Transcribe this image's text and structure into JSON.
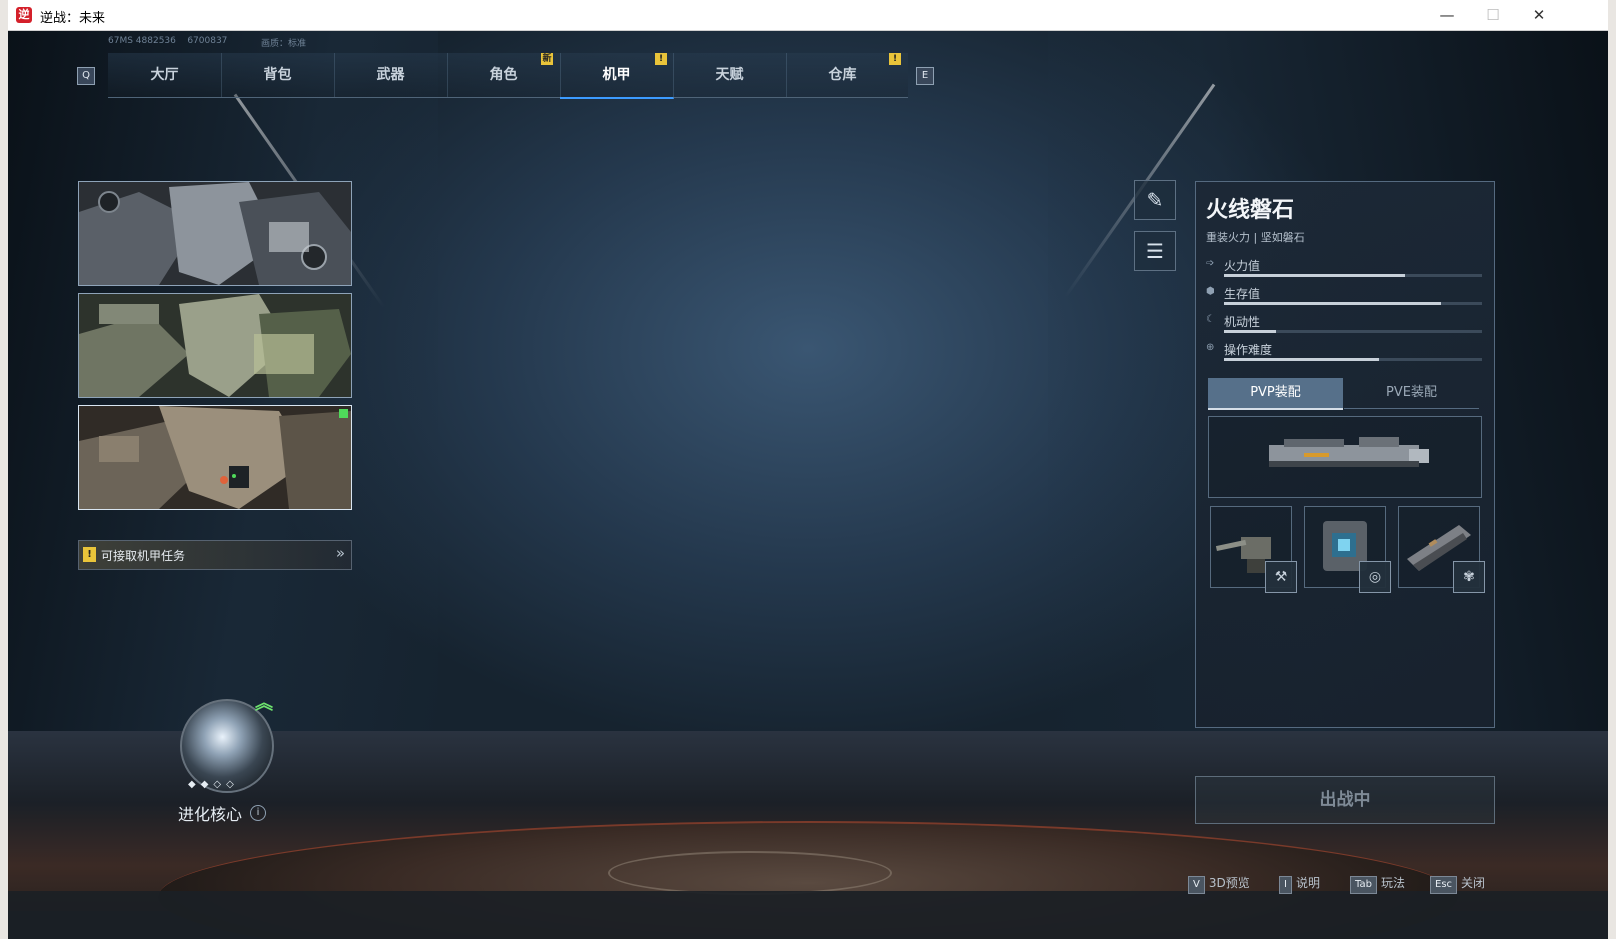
{
  "window": {
    "app_icon": "逆",
    "title": "逆战：未来",
    "minimize": "—",
    "maximize": "☐",
    "close": "✕"
  },
  "meta": {
    "ping": "67MS  4882536",
    "id_tail": "6700837",
    "quality": "画质：标准"
  },
  "nav": {
    "left_key": "Q",
    "right_key": "E",
    "tabs": [
      {
        "label": "大厅"
      },
      {
        "label": "背包"
      },
      {
        "label": "武器"
      },
      {
        "label": "角色",
        "badge": "新"
      },
      {
        "label": "机甲",
        "badge": "!",
        "active": true
      },
      {
        "label": "天赋"
      },
      {
        "label": "仓库",
        "badge": "!"
      }
    ]
  },
  "mech_cards": [
    {
      "name": "mech-card-1",
      "selected": false
    },
    {
      "name": "mech-card-2",
      "selected": false
    },
    {
      "name": "mech-card-3",
      "selected": true
    }
  ],
  "task": {
    "icon": "!",
    "label": "可接取机甲任务",
    "arrow": "»"
  },
  "core": {
    "up_icon": "︽",
    "dots": "◆◆◇◇",
    "label": "进化核心",
    "info": "i"
  },
  "tools": {
    "spray_icon": "✎",
    "list_icon": "☰"
  },
  "panel": {
    "name": "火线磐石",
    "subtitle": "重装火力 | 坚如磐石",
    "stats": [
      {
        "label": "火力值",
        "icon": "➩",
        "value": 0.7
      },
      {
        "label": "生存值",
        "icon": "⬢",
        "value": 0.84
      },
      {
        "label": "机动性",
        "icon": "☾",
        "value": 0.2
      },
      {
        "label": "操作难度",
        "icon": "⊕",
        "value": 0.6
      }
    ],
    "loadout_tabs": {
      "pvp": "PVP装配",
      "pve": "PVE装配"
    },
    "slot_icons": [
      "⚒",
      "◎",
      "✾"
    ]
  },
  "deploy_button": "出战中",
  "hints": [
    {
      "key": "V",
      "label": "3D预览"
    },
    {
      "key": "I",
      "label": "说明"
    },
    {
      "key": "Tab",
      "label": "玩法"
    },
    {
      "key": "Esc",
      "label": "关闭"
    }
  ]
}
